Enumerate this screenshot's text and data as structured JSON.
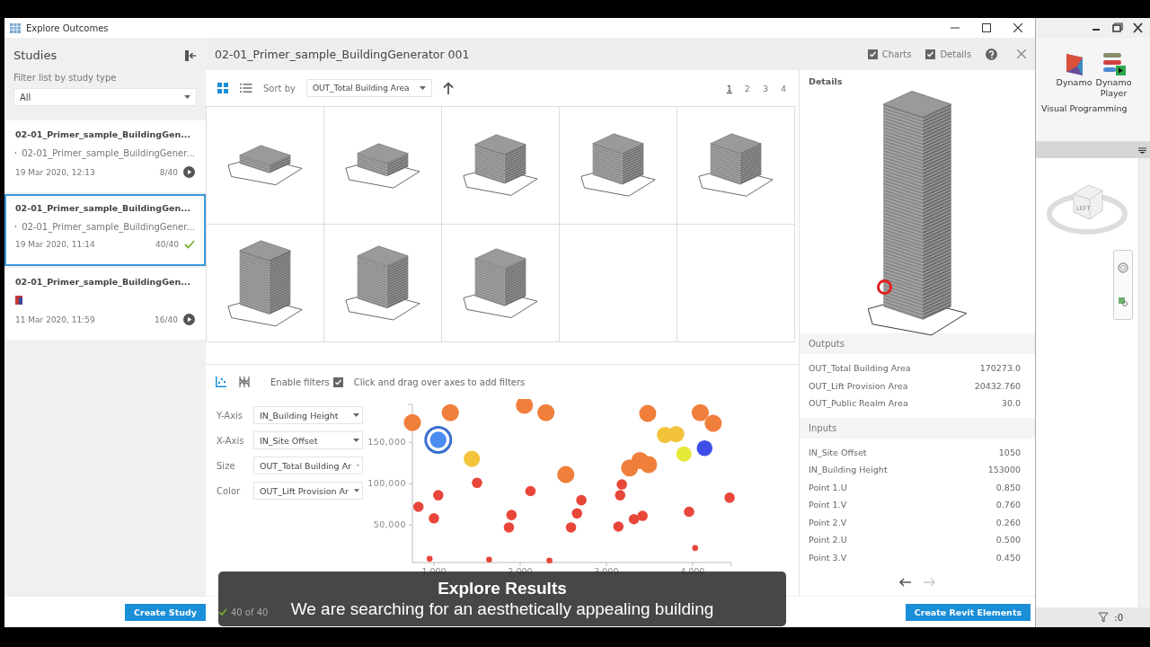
{
  "window": {
    "title": "Explore Outcomes"
  },
  "sidebar": {
    "title": "Studies",
    "filter_label": "Filter list by study type",
    "filter_value": "All",
    "studies": [
      {
        "title": "02-01_Primer_sample_BuildingGen...",
        "source": "02-01_Primer_sample_BuildingGener...",
        "date": "19 Mar 2020, 12:13",
        "count": "8/40",
        "kind": "play",
        "selected": false
      },
      {
        "title": "02-01_Primer_sample_BuildingGen...",
        "source": "02-01_Primer_sample_BuildingGener...",
        "date": "19 Mar 2020, 11:14",
        "count": "40/40",
        "kind": "done",
        "selected": true
      },
      {
        "title": "02-01_Primer_sample_BuildingGen...",
        "date": "11 Mar 2020, 11:59",
        "count": "16/40",
        "kind": "play",
        "selected": false
      }
    ],
    "create_button": "Create Study"
  },
  "header": {
    "title": "02-01_Primer_sample_BuildingGenerator 001",
    "toggles": [
      {
        "label": "Charts",
        "checked": true
      },
      {
        "label": "Details",
        "checked": true
      }
    ]
  },
  "toolbar": {
    "views": [
      {
        "kind": "grid",
        "selected": true
      },
      {
        "kind": "list",
        "selected": false
      }
    ],
    "sort_label": "Sort by",
    "sort_value": "OUT_Total Building Area",
    "pages": [
      {
        "label": "1",
        "selected": true
      },
      {
        "label": "2",
        "selected": false
      },
      {
        "label": "3",
        "selected": false
      },
      {
        "label": "4",
        "selected": false
      }
    ]
  },
  "outcomes": [
    {
      "kind": "building"
    },
    {
      "kind": "building"
    },
    {
      "kind": "building"
    },
    {
      "kind": "building"
    },
    {
      "kind": "building"
    },
    {
      "kind": "building"
    },
    {
      "kind": "building"
    },
    {
      "kind": "building"
    }
  ],
  "charts": {
    "views": [
      {
        "kind": "scatter",
        "selected": true
      },
      {
        "kind": "parallel",
        "selected": false
      }
    ],
    "filters_label": "Enable filters",
    "filters_enabled": true,
    "hint": "Click and drag over axes to add filters",
    "axes": [
      {
        "label": "Y-Axis",
        "value": "IN_Building Height"
      },
      {
        "label": "X-Axis",
        "value": "IN_Site Offset"
      },
      {
        "label": "Size",
        "value": "OUT_Total Building Ar"
      },
      {
        "label": "Color",
        "value": "OUT_Lift Provision Ar"
      }
    ],
    "chart_data": {
      "type": "scatter",
      "xlim": [
        750,
        4450
      ],
      "ylim": [
        4500,
        196000
      ],
      "xticks": [
        {
          "value": 1000,
          "label": "1,000"
        },
        {
          "value": 2000,
          "label": "2,000"
        },
        {
          "value": 3000,
          "label": "3,000"
        },
        {
          "value": 4000,
          "label": "4,000"
        }
      ],
      "yticks": [
        {
          "value": 50000,
          "label": "50,000"
        },
        {
          "value": 100000,
          "label": "100,000"
        },
        {
          "value": 150000,
          "label": "150,000"
        }
      ],
      "series": [
        {
          "color": "#4a8cf0",
          "x": [
            1050
          ],
          "values": [
            153000
          ]
        },
        {
          "color": "#3d4fe8",
          "x": [
            4140
          ],
          "values": [
            143000
          ]
        },
        {
          "color": "#f07f3c",
          "x": [
            750,
            1190,
            2050,
            2300,
            3480,
            4090,
            4240,
            3270,
            3390,
            3490,
            2530
          ],
          "values": [
            174000,
            186000,
            195000,
            186000,
            185000,
            186000,
            173000,
            119000,
            128000,
            123000,
            111000
          ]
        },
        {
          "color": "#f3c33c",
          "x": [
            1440,
            3680,
            3810
          ],
          "values": [
            130000,
            159000,
            160000
          ]
        },
        {
          "color": "#e3ea3a",
          "x": [
            3900
          ],
          "values": [
            136000
          ]
        },
        {
          "color": "#e8463a",
          "x": [
            1500,
            1050,
            820,
            1000,
            2120,
            1900,
            1870,
            2710,
            2660,
            2590,
            3160,
            3180,
            4430,
            3960,
            3420,
            3320,
            3140
          ],
          "values": [
            101000,
            86000,
            72000,
            58000,
            91000,
            62000,
            47000,
            80000,
            64000,
            47000,
            86000,
            99000,
            83000,
            66000,
            61000,
            57000,
            48000
          ]
        },
        {
          "color": "#e8463a",
          "x": [
            4030,
            950,
            1640,
            2340
          ],
          "values": [
            22000,
            9000,
            8000,
            7000
          ]
        }
      ]
    }
  },
  "details": {
    "title": "Details",
    "sections": [
      {
        "title": "Outputs",
        "rows": [
          {
            "label": "OUT_Total Building Area",
            "value": "170273.0"
          },
          {
            "label": "OUT_Lift Provision Area",
            "value": "20432.760"
          },
          {
            "label": "OUT_Public Realm Area",
            "value": "30.0"
          }
        ]
      },
      {
        "title": "Inputs",
        "rows": [
          {
            "label": "IN_Site Offset",
            "value": "1050"
          },
          {
            "label": "IN_Building Height",
            "value": "153000"
          },
          {
            "label": "Point 1.U",
            "value": "0.850"
          },
          {
            "label": "Point 1.V",
            "value": "0.760"
          },
          {
            "label": "Point 2.V",
            "value": "0.260"
          },
          {
            "label": "Point 2.U",
            "value": "0.500"
          },
          {
            "label": "Point 3.V",
            "value": "0.450"
          }
        ]
      }
    ],
    "prev_disabled": false,
    "next_disabled": true,
    "create_button": "Create Revit Elements"
  },
  "status": {
    "count": "40 of 40"
  },
  "revit": {
    "tools": [
      {
        "kind": "dynamo",
        "label": "Dynamo"
      },
      {
        "kind": "player",
        "label": "Dynamo Player"
      }
    ],
    "panel_title": "Visual Programming",
    "viewcube_label": "LEFT",
    "filter_count": ":0"
  },
  "caption": {
    "title": "Explore Results",
    "text": "We are searching for an aesthetically appealing building"
  }
}
